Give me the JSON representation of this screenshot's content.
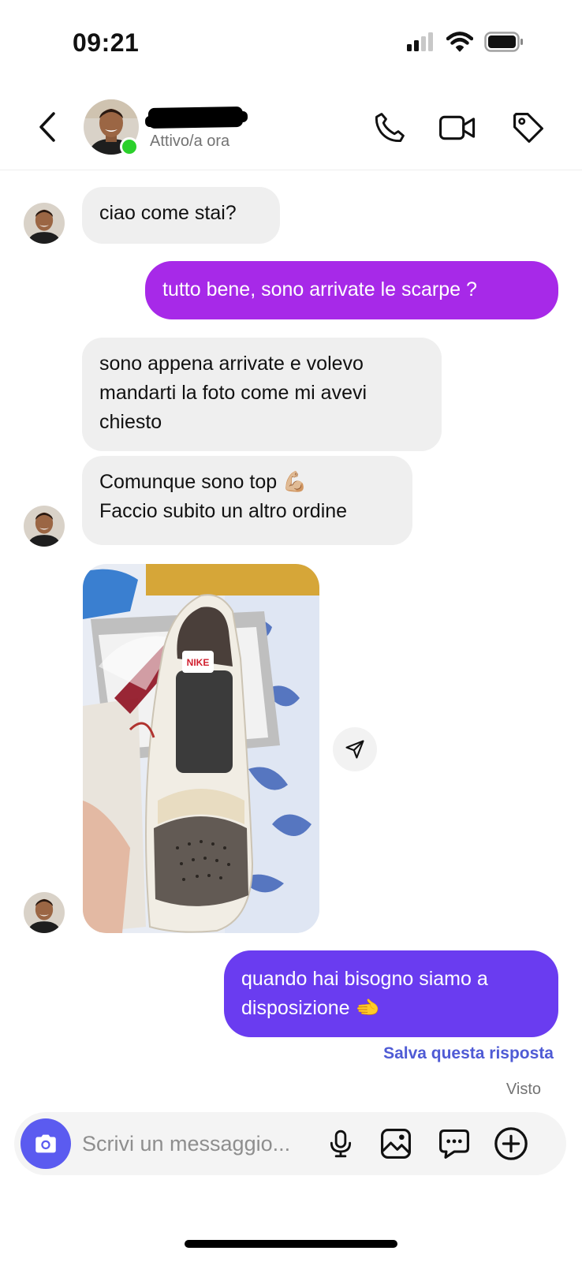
{
  "status_bar": {
    "time": "09:21",
    "icons": [
      "cellular-signal-icon",
      "wifi-icon",
      "battery-icon"
    ]
  },
  "header": {
    "contact_status": "Attivo/a ora",
    "actions": [
      "back-icon",
      "phone-icon",
      "video-icon",
      "tag-icon"
    ]
  },
  "messages": [
    {
      "sender": "them",
      "text": "ciao come stai?"
    },
    {
      "sender": "me",
      "text": "tutto bene, sono arrivate le scarpe ?"
    },
    {
      "sender": "them",
      "text": "sono appena arrivate e volevo mandarti la foto come mi avevi chiesto"
    },
    {
      "sender": "them",
      "line1": "Comunque sono top 💪🏼",
      "line2": "Faccio subito un altro ordine"
    },
    {
      "sender": "them",
      "type": "photo",
      "content": "sneaker-photo"
    },
    {
      "sender": "me",
      "text": "quando hai bisogno siamo a disposizione 🫲"
    }
  ],
  "save_reply_label": "Salva questa risposta",
  "seen_label": "Visto",
  "composer": {
    "placeholder": "Scrivi un messaggio...",
    "icons": [
      "camera-icon",
      "microphone-icon",
      "gallery-icon",
      "sticker-chat-icon",
      "plus-icon"
    ]
  },
  "colors": {
    "incoming_bubble": "#efefef",
    "outgoing_bubble_1": "#a729e8",
    "outgoing_bubble_2": "#6a3cf0",
    "accent": "#4f5bd5",
    "camera_button": "#5b5bf0",
    "online": "#2bd02b"
  }
}
